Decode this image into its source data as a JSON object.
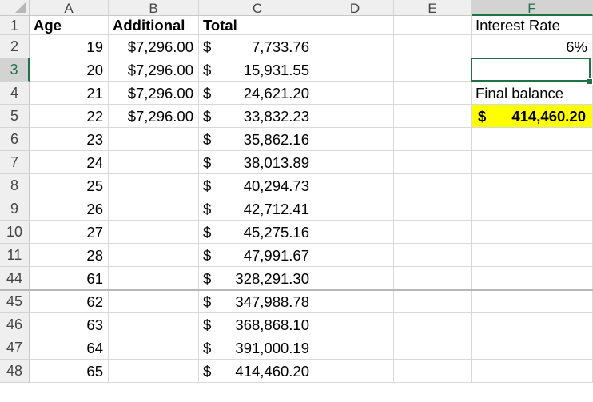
{
  "columns": [
    "A",
    "B",
    "C",
    "D",
    "E",
    "F"
  ],
  "selected_cell": {
    "row": "3",
    "column": "F"
  },
  "headers": {
    "A1": "Age",
    "B1": "Additional",
    "C1": "Total"
  },
  "rows": [
    {
      "row": "2",
      "age": "19",
      "additional": "$7,296.00",
      "total_currency": "$",
      "total": "7,733.76"
    },
    {
      "row": "3",
      "age": "20",
      "additional": "$7,296.00",
      "total_currency": "$",
      "total": "15,931.55"
    },
    {
      "row": "4",
      "age": "21",
      "additional": "$7,296.00",
      "total_currency": "$",
      "total": "24,621.20"
    },
    {
      "row": "5",
      "age": "22",
      "additional": "$7,296.00",
      "total_currency": "$",
      "total": "33,832.23"
    },
    {
      "row": "6",
      "age": "23",
      "additional": "",
      "total_currency": "$",
      "total": "35,862.16"
    },
    {
      "row": "7",
      "age": "24",
      "additional": "",
      "total_currency": "$",
      "total": "38,013.89"
    },
    {
      "row": "8",
      "age": "25",
      "additional": "",
      "total_currency": "$",
      "total": "40,294.73"
    },
    {
      "row": "9",
      "age": "26",
      "additional": "",
      "total_currency": "$",
      "total": "42,712.41"
    },
    {
      "row": "10",
      "age": "27",
      "additional": "",
      "total_currency": "$",
      "total": "45,275.16"
    },
    {
      "row": "11",
      "age": "28",
      "additional": "",
      "total_currency": "$",
      "total": "47,991.67"
    },
    {
      "row": "44",
      "age": "61",
      "additional": "",
      "total_currency": "$",
      "total": "328,291.30"
    },
    {
      "row": "45",
      "age": "62",
      "additional": "",
      "total_currency": "$",
      "total": "347,988.78"
    },
    {
      "row": "46",
      "age": "63",
      "additional": "",
      "total_currency": "$",
      "total": "368,868.10"
    },
    {
      "row": "47",
      "age": "64",
      "additional": "",
      "total_currency": "$",
      "total": "391,000.19"
    },
    {
      "row": "48",
      "age": "65",
      "additional": "",
      "total_currency": "$",
      "total": "414,460.20"
    }
  ],
  "side_panel": {
    "interest_label": "Interest Rate",
    "interest_value": "6%",
    "final_label": "Final balance",
    "final_currency": "$",
    "final_value": "414,460.20",
    "highlight_color": "#ffff00"
  },
  "colors": {
    "accent": "#217346"
  }
}
